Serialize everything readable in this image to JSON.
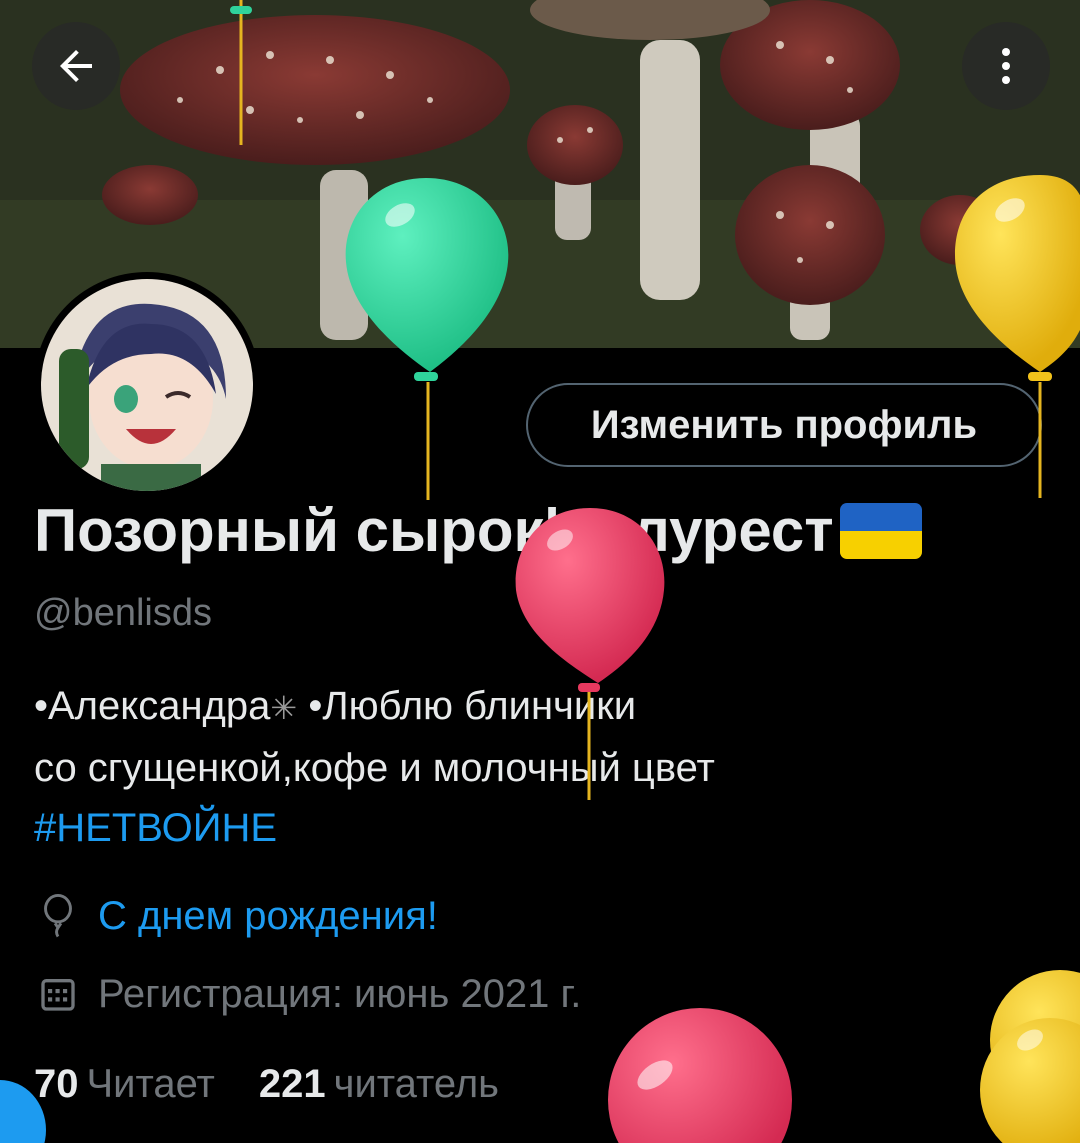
{
  "header": {
    "back_icon": "arrow-left-icon",
    "more_icon": "more-vertical-icon"
  },
  "profile": {
    "edit_button": "Изменить профиль",
    "display_name": "Позорный сырок|полурест",
    "flag": "ukraine-flag",
    "handle": "@benlisds",
    "bio_line1a": "•Александра",
    "bio_line1b": "•Люблю блинчики",
    "bio_line2": "со сгущенкой,кофе и молочный цвет",
    "bio_hashtag": "#НЕТВОЙНЕ",
    "birthday": "С днем рождения!",
    "joined": "Регистрация: июнь 2021 г.",
    "following_count": "70",
    "following_label": "Читает",
    "followers_count": "221",
    "followers_label": "читатель"
  },
  "colors": {
    "link": "#1d9bf0",
    "muted": "#71767b",
    "text": "#e7e9ea",
    "balloon_green": "#2fd39b",
    "balloon_yellow": "#f2c21b",
    "balloon_red": "#e8395f"
  }
}
